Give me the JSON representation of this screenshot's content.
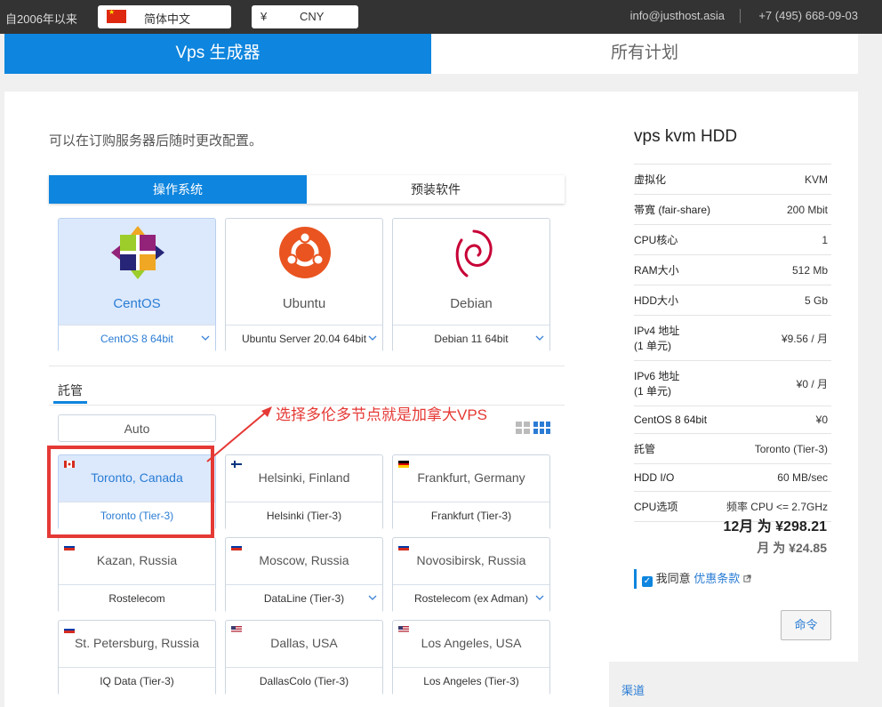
{
  "topbar": {
    "since": "自2006年以来",
    "language": "简体中文",
    "currency_symbol": "¥",
    "currency": "CNY",
    "email": "info@justhost.asia",
    "phone": "+7 (495) 668-09-03"
  },
  "main_tabs": {
    "active": "Vps 生成器",
    "inactive": "所有计划"
  },
  "config": {
    "hint": "可以在订购服务器后随时更改配置。",
    "subtabs": {
      "os": "操作系统",
      "software": "预装软件"
    },
    "os_options": [
      {
        "name": "CentOS",
        "version": "CentOS 8 64bit",
        "logo": "centos-logo",
        "selected": true
      },
      {
        "name": "Ubuntu",
        "version": "Ubuntu Server 20.04 64bit",
        "logo": "ubuntu-logo",
        "selected": false
      },
      {
        "name": "Debian",
        "version": "Debian 11 64bit",
        "logo": "debian-logo",
        "selected": false
      }
    ],
    "hosting_label": "託管",
    "auto_label": "Auto",
    "annotation": "选择多伦多节点就是加拿大VPS",
    "locations": [
      {
        "city": "Toronto, Canada",
        "dc": "Toronto (Tier-3)",
        "flag": "ca-flag",
        "selected": true
      },
      {
        "city": "Helsinki, Finland",
        "dc": "Helsinki (Tier-3)",
        "flag": "fi-flag",
        "selected": false
      },
      {
        "city": "Frankfurt, Germany",
        "dc": "Frankfurt (Tier-3)",
        "flag": "de-flag",
        "selected": false
      },
      {
        "city": "Kazan, Russia",
        "dc": "Rostelecom",
        "flag": "ru-flag",
        "selected": false
      },
      {
        "city": "Moscow, Russia",
        "dc": "DataLine (Tier-3)",
        "flag": "ru-flag",
        "selected": false,
        "dropdown": true
      },
      {
        "city": "Novosibirsk, Russia",
        "dc": "Rostelecom (ex Adman)",
        "flag": "ru-flag",
        "selected": false,
        "dropdown": true
      },
      {
        "city": "St. Petersburg, Russia",
        "dc": "IQ Data (Tier-3)",
        "flag": "ru-flag",
        "selected": false
      },
      {
        "city": "Dallas, USA",
        "dc": "DallasColo (Tier-3)",
        "flag": "us-flag",
        "selected": false
      },
      {
        "city": "Los Angeles, USA",
        "dc": "Los Angeles (Tier-3)",
        "flag": "us-flag",
        "selected": false
      }
    ]
  },
  "summary": {
    "title": "vps kvm HDD",
    "rows": [
      {
        "key": "虚拟化",
        "value": "KVM"
      },
      {
        "key": "帯寬 (fair-share)",
        "value": "200 Mbit"
      },
      {
        "key": "CPU核心",
        "value": "1"
      },
      {
        "key": "RAM大小",
        "value": "512 Mb"
      },
      {
        "key": "HDD大小",
        "value": "5 Gb"
      },
      {
        "key": "IPv4 地址",
        "key2": "(1 单元)",
        "value": "¥9.56 / 月"
      },
      {
        "key": "IPv6 地址",
        "key2": "(1 单元)",
        "value": "¥0 / 月"
      },
      {
        "key": "CentOS 8 64bit",
        "value": "¥0"
      },
      {
        "key": "託管",
        "value": "Toronto (Tier-3)"
      },
      {
        "key": "HDD I/O",
        "value": "60 MB/sec"
      },
      {
        "key": "CPU选项",
        "value": "频率 CPU <= 2.7GHz"
      }
    ],
    "total": "12月 为 ¥298.21",
    "monthly": "月 为 ¥24.85",
    "agree_text": "我同意",
    "terms_link": "优惠条款",
    "order_button": "命令"
  },
  "footer": {
    "channel": "渠道"
  },
  "colors": {
    "accent": "#0e85de",
    "selected_bg": "#dce9fc",
    "annotation": "#e53935"
  }
}
